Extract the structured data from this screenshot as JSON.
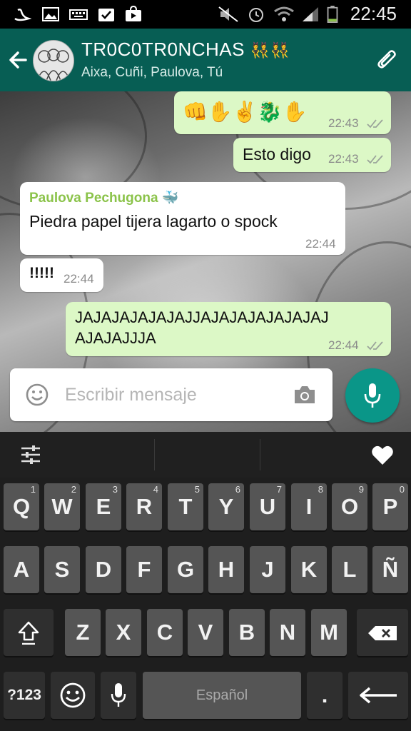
{
  "status_bar": {
    "time": "22:45"
  },
  "header": {
    "title": "TR0C0TR0NCHAS",
    "title_emoji": "👯👯",
    "participants": "Aixa, Cuñi, Paulova, Tú"
  },
  "messages": [
    {
      "direction": "out",
      "text": "👊✋✌️🐉✋",
      "time": "22:43"
    },
    {
      "direction": "out",
      "text": "Esto digo",
      "time": "22:43"
    },
    {
      "direction": "in",
      "sender": "Paulova Pechugona",
      "sender_emoji": "🐳",
      "text": "Piedra papel tijera lagarto o spock",
      "time": "22:44"
    },
    {
      "direction": "in",
      "text": "!!!!!",
      "time": "22:44"
    },
    {
      "direction": "out",
      "text_line1": "JAJAJAJAJAJAJJAJAJAJAJAJAJAJ",
      "text_line2": "AJAJAJJJA",
      "time": "22:44"
    }
  ],
  "composer": {
    "placeholder": "Escribir mensaje"
  },
  "keyboard": {
    "row1": [
      "Q",
      "W",
      "E",
      "R",
      "T",
      "Y",
      "U",
      "I",
      "O",
      "P"
    ],
    "row1_nums": [
      "1",
      "2",
      "3",
      "4",
      "5",
      "6",
      "7",
      "8",
      "9",
      "0"
    ],
    "row2": [
      "A",
      "S",
      "D",
      "F",
      "G",
      "H",
      "J",
      "K",
      "L",
      "Ñ"
    ],
    "row3": [
      "Z",
      "X",
      "C",
      "V",
      "B",
      "N",
      "M"
    ],
    "symbols_label": "?123",
    "space_label": "Español",
    "period_label": "."
  },
  "colors": {
    "header": "#075e54",
    "outgoing_bubble": "#dcf8c6",
    "incoming_bubble": "#ffffff",
    "mic_button": "#0a9688",
    "sender_name": "#8bc34a"
  }
}
